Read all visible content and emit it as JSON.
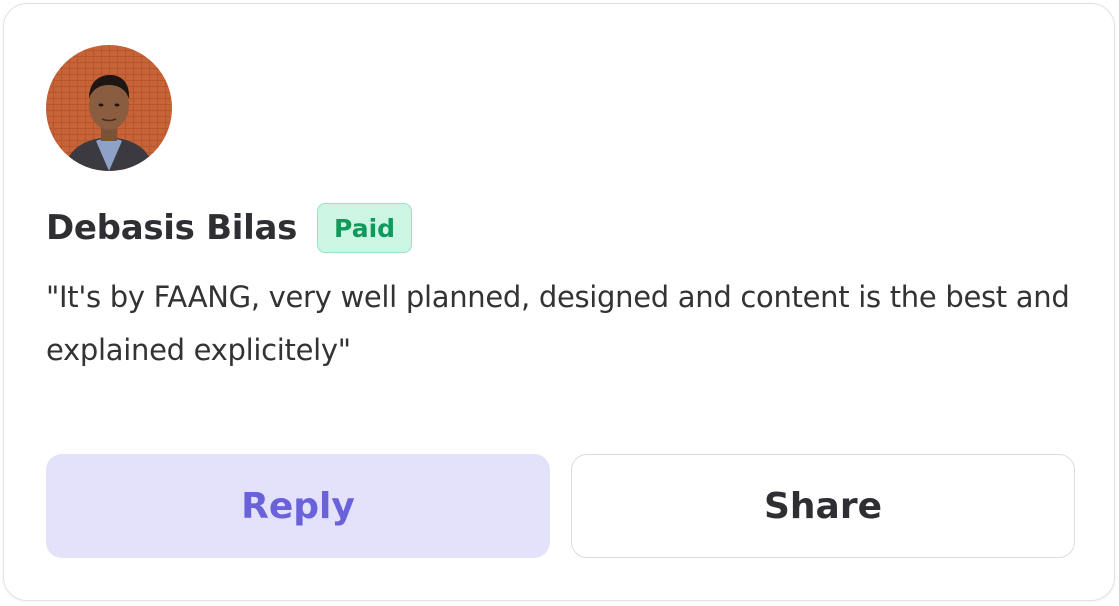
{
  "review": {
    "author_name": "Debasis Bilas",
    "badge_label": "Paid",
    "quote": "\"It's by FAANG, very well planned, designed and content is the best and explained explicitely\""
  },
  "actions": {
    "reply_label": "Reply",
    "share_label": "Share"
  },
  "colors": {
    "badge_bg": "#ccf5e3",
    "badge_text": "#0f9a5c",
    "reply_bg": "#e4e2fb",
    "reply_text": "#6a62da"
  }
}
